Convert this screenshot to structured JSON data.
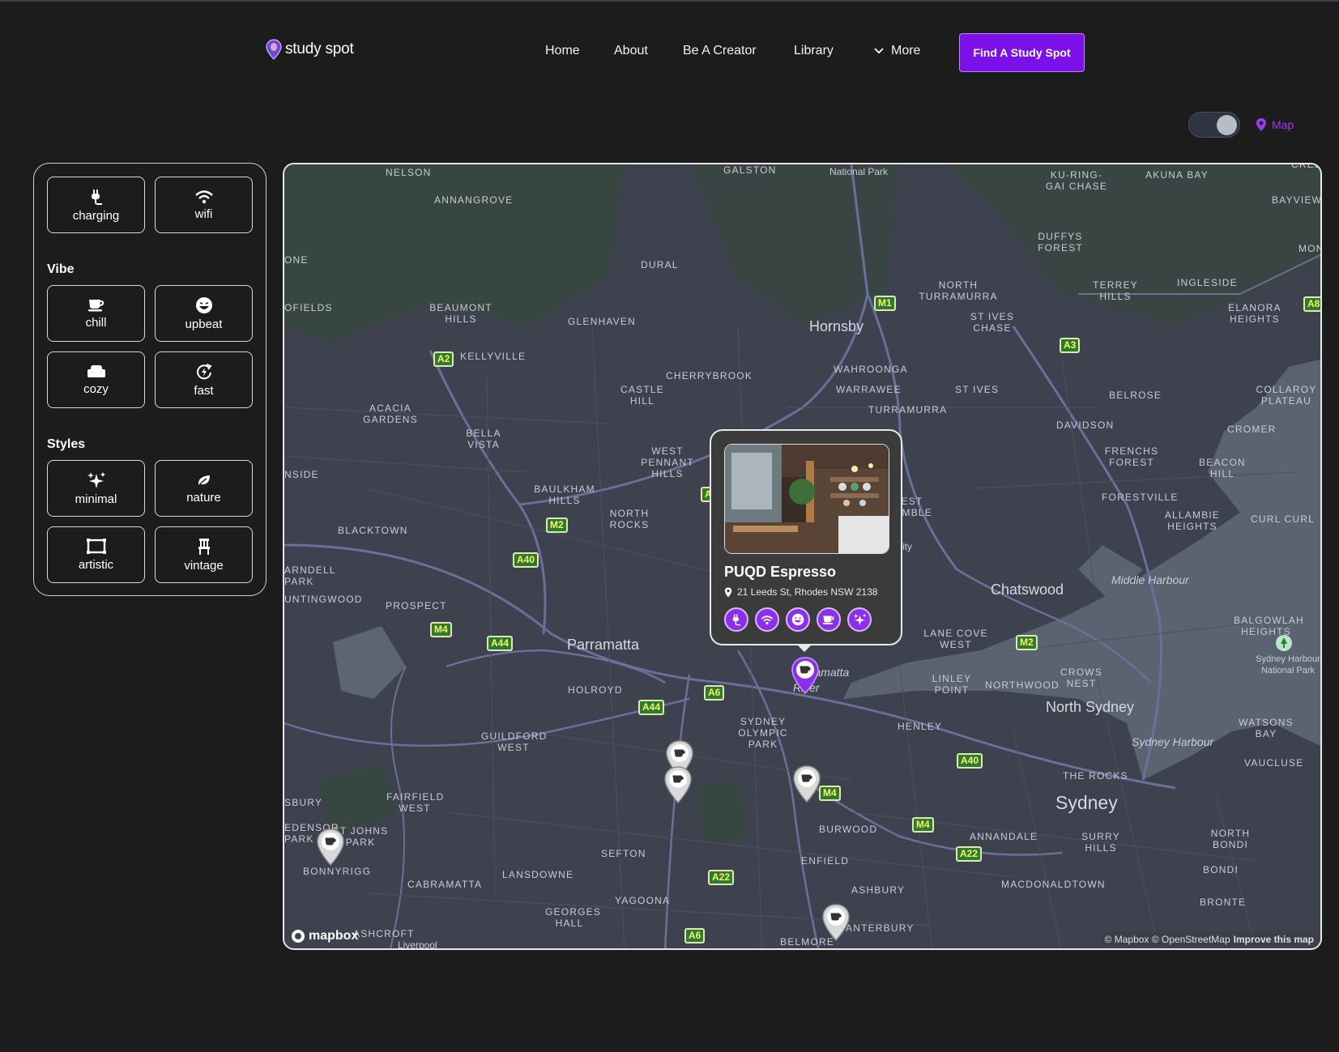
{
  "brand": {
    "name": "study spot"
  },
  "nav": {
    "home": "Home",
    "about": "About",
    "creator": "Be A Creator",
    "library": "Library",
    "more": "More",
    "cta": "Find A Study Spot"
  },
  "view_toggle": {
    "label": "Map",
    "accent": "#9a3df0"
  },
  "filters": {
    "amenities": [
      {
        "label": "charging",
        "icon": "plug-icon"
      },
      {
        "label": "wifi",
        "icon": "wifi-icon"
      }
    ],
    "vibe_title": "Vibe",
    "vibe": [
      {
        "label": "chill",
        "icon": "coffee-cup-icon"
      },
      {
        "label": "upbeat",
        "icon": "laughing-face-icon"
      },
      {
        "label": "cozy",
        "icon": "armchair-icon"
      },
      {
        "label": "fast",
        "icon": "lightning-refresh-icon"
      }
    ],
    "styles_title": "Styles",
    "styles": [
      {
        "label": "minimal",
        "icon": "sparkles-icon"
      },
      {
        "label": "nature",
        "icon": "leaf-icon"
      },
      {
        "label": "artistic",
        "icon": "frame-icon"
      },
      {
        "label": "vintage",
        "icon": "chair-icon"
      }
    ]
  },
  "map": {
    "places": [
      "NELSON",
      "GALSTON",
      "National Park",
      "KU-RING-GAI CHASE",
      "AKUNA BAY",
      "BAYVIEW",
      "CREEK",
      "ANNANGROVE",
      "DURAL",
      "DUFFYS FOREST",
      "MONA V",
      "ONE",
      "OFIELDS",
      "BEAUMONT HILLS",
      "GLENHAVEN",
      "NORTH TURRAMURRA",
      "TERREY HILLS",
      "INGLESIDE",
      "ELANORA HEIGHTS",
      "ST IVES CHASE",
      "KELLYVILLE",
      "CHERRYBROOK",
      "WAHROONGA",
      "WARRAWEE",
      "ST IVES",
      "BELROSE",
      "COLLAROY PLATEAU",
      "CASTLE HILL",
      "ACACIA GARDENS",
      "BELLA VISTA",
      "TURRAMURRA",
      "DAVIDSON",
      "CROMER",
      "WEST PENNANT HILLS",
      "FRENCHS FOREST",
      "BEACON HILL",
      "NSIDE",
      "BAULKHAM HILLS",
      "EST IMBLE",
      "FORESTVILLE",
      "ALLAMBIE HEIGHTS",
      "CURL CURL",
      "BLACKTOWN",
      "NORTH ROCKS",
      "ARNDELL PARK",
      "UNTINGWOOD",
      "PROSPECT",
      "LANE COVE WEST",
      "BALGOWLAH HEIGHTS",
      "HOLROYD",
      "LINLEY POINT",
      "NORTHWOOD",
      "CROWS NEST",
      "SYDNEY OLYMPIC PARK",
      "HENLEY",
      "GUILDFORD WEST",
      "WATSONS BAY",
      "THE ROCKS",
      "VAUCLUSE",
      "SBURY",
      "FAIRFIELD WEST",
      "EDENSOR PARK",
      "ST JOHNS PARK",
      "BURWOOD",
      "ANNANDALE",
      "SURRY HILLS",
      "NORTH BONDI",
      "SEFTON",
      "BONNYRIGG",
      "ENFIELD",
      "BONDI",
      "CABRAMATTA",
      "LANSDOWNE",
      "ASHBURY",
      "MACDONALDTOWN",
      "BRONTE",
      "YAGOONA",
      "GEORGES HALL",
      "ANTERBURY",
      "ASHCROFT",
      "BELMORE",
      "Liverpool",
      "ity"
    ],
    "cities": [
      "Hornsby",
      "Parramatta",
      "Chatswood",
      "North Sydney",
      "Sydney"
    ],
    "water": [
      "Middle Harbour",
      "Sydney Harbour",
      "Parramatta River"
    ],
    "poi": "Sydney Harbour National Park",
    "roads": [
      "M1",
      "A3",
      "A8",
      "A2",
      "M2",
      "A40",
      "M4",
      "A44",
      "A6",
      "A44",
      "M2",
      "A40",
      "M4",
      "M4",
      "A22",
      "A22",
      "A6",
      "A"
    ],
    "attribution": "© Mapbox © OpenStreetMap",
    "improve": "Improve this map",
    "logo": "mapbox"
  },
  "popup": {
    "name": "PUQD Espresso",
    "address": "21 Leeds St, Rhodes NSW 2138",
    "tags": [
      "plug-icon",
      "wifi-icon",
      "laughing-face-icon",
      "coffee-cup-icon",
      "sparkles-icon"
    ]
  },
  "colors": {
    "accent": "#7b10e8",
    "background": "#1c1c1c",
    "map": "#3a3f4b"
  }
}
